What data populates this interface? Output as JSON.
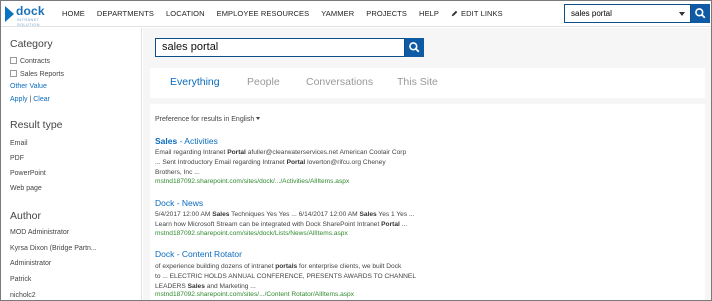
{
  "logo": {
    "text": "dock",
    "sub": "INTRANET SOLUTION"
  },
  "nav": [
    "HOME",
    "DEPARTMENTS",
    "LOCATION",
    "EMPLOYEE RESOURCES",
    "YAMMER",
    "PROJECTS",
    "HELP"
  ],
  "edit_links": "EDIT LINKS",
  "top_search": {
    "value": "sales portal"
  },
  "refiners": {
    "category": {
      "heading": "Category",
      "options": [
        "Contracts",
        "Sales Reports"
      ],
      "other": "Other Value",
      "apply": "Apply",
      "sep": "|",
      "clear": "Clear"
    },
    "result_type": {
      "heading": "Result type",
      "items": [
        "Email",
        "PDF",
        "PowerPoint",
        "Web page"
      ]
    },
    "author": {
      "heading": "Author",
      "items": [
        "MOD Administrator",
        "Kyrsa Dixon (Bridge Partn...",
        "Administrator",
        "Patrick",
        "nicholc2"
      ]
    }
  },
  "main_search": {
    "value": "sales portal"
  },
  "tabs": [
    "Everything",
    "People",
    "Conversations",
    "This Site"
  ],
  "active_tab": "Everything",
  "preference": "Preference for results in English",
  "results": [
    {
      "title_parts": [
        {
          "t": "Sales",
          "b": true
        },
        {
          "t": " - Activities",
          "b": false
        }
      ],
      "summary_lines": [
        [
          {
            "t": "Email regarding Intranet ",
            "b": false
          },
          {
            "t": "Portal",
            "b": true
          },
          {
            "t": " afuller@clearwaterservices.net American Coolair Corp",
            "b": false
          }
        ],
        [
          {
            "t": "... Sent Introductory Email regarding Intranet ",
            "b": false
          },
          {
            "t": "Portal",
            "b": true
          },
          {
            "t": " loverton@rifcu.org Cheney",
            "b": false
          }
        ],
        [
          {
            "t": "Brothers, Inc ...",
            "b": false
          }
        ]
      ],
      "url": "mstnd187092.sharepoint.com/sites/dock/.../Activities/AllItems.aspx"
    },
    {
      "title_parts": [
        {
          "t": "Dock - News",
          "b": false
        }
      ],
      "summary_lines": [
        [
          {
            "t": "5/4/2017 12:00 AM ",
            "b": false
          },
          {
            "t": "Sales",
            "b": true
          },
          {
            "t": " Techniques Yes Yes ... 6/14/2017 12:00 AM ",
            "b": false
          },
          {
            "t": "Sales",
            "b": true
          },
          {
            "t": " Yes 1 Yes ...",
            "b": false
          }
        ],
        [
          {
            "t": "Learn how Microsoft Stream can be integrated with Dock SharePoint Intranet ",
            "b": false
          },
          {
            "t": "Portal",
            "b": true
          },
          {
            "t": " ...",
            "b": false
          }
        ]
      ],
      "url": "mstnd187092.sharepoint.com/sites/dock/Lists/News/AllItems.aspx"
    },
    {
      "title_parts": [
        {
          "t": "Dock - Content Rotator",
          "b": false
        }
      ],
      "summary_lines": [
        [
          {
            "t": "of experience building dozens of intranet ",
            "b": false
          },
          {
            "t": "portals",
            "b": true
          },
          {
            "t": " for enterprise clients, we built Dock",
            "b": false
          }
        ],
        [
          {
            "t": "to ... ELECTRIC HOLDS ANNUAL CONFERENCE, PRESENTS AWARDS TO CHANNEL",
            "b": false
          }
        ],
        [
          {
            "t": "LEADERS ",
            "b": false
          },
          {
            "t": "Sales",
            "b": true
          },
          {
            "t": " and Marketing ...",
            "b": false
          }
        ]
      ],
      "url": "mstnd187092.sharepoint.com/sites/.../Content Rotator/AllItems.aspx"
    }
  ],
  "colors": {
    "accent": "#0a6bbf",
    "button": "#0f5aa5",
    "url": "#2f8a2f"
  },
  "icons": [
    "dock-logo-icon",
    "pencil-icon",
    "chevron-down-icon",
    "search-icon"
  ]
}
